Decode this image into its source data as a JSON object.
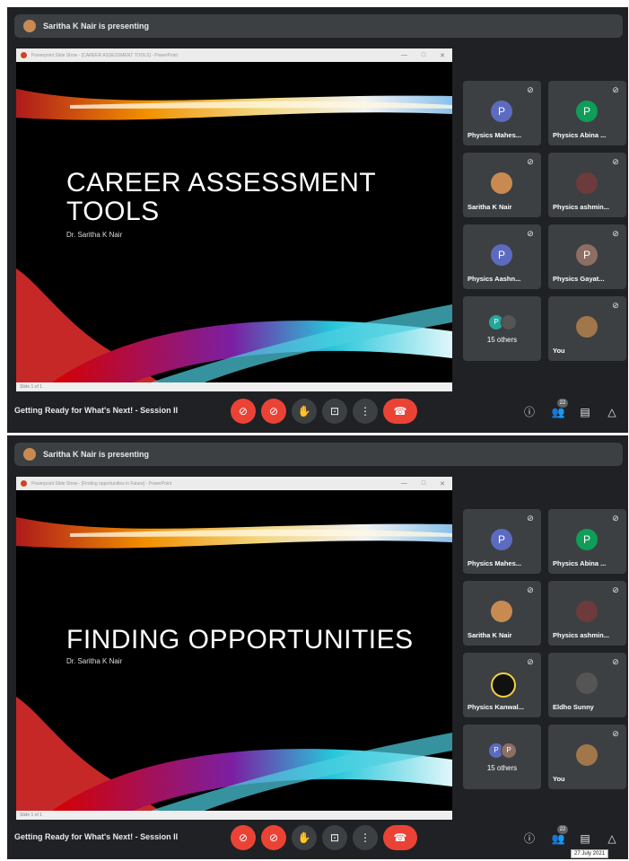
{
  "presenting_text": "Saritha K Nair is presenting",
  "meeting_title": "Getting Ready for What's Next! - Session II",
  "participant_count": "22",
  "date_tooltip": "27 July 2021",
  "slide1": {
    "window_title": "Powerpoint Slide Show - [CAREER ASSESSMENT TOOLS] - PowerPoint",
    "title_line1": "CAREER ASSESSMENT",
    "title_line2": "TOOLS",
    "subtitle": "Dr. Saritha K Nair",
    "footer": "Slide 1 of 1"
  },
  "slide2": {
    "window_title": "Powerpoint Slide Show - [Finding opportunities in Future] - PowerPoint",
    "title_line1": "FINDING OPPORTUNITIES",
    "subtitle": "Dr. Saritha K Nair",
    "footer": "Slide 1 of 1"
  },
  "tiles1": [
    {
      "name": "Physics Mahes...",
      "initial": "P",
      "color": "#5c6bc0"
    },
    {
      "name": "Physics Abina ...",
      "initial": "P",
      "color": "#0f9d58"
    },
    {
      "name": "Saritha K Nair",
      "initial": "",
      "color": "#c98a52"
    },
    {
      "name": "Physics ashmin...",
      "initial": "",
      "color": "#6d3b3b"
    },
    {
      "name": "Physics Aashn...",
      "initial": "P",
      "color": "#5c6bc0"
    },
    {
      "name": "Physics Gayat...",
      "initial": "P",
      "color": "#8d6e63"
    },
    {
      "name": "15 others",
      "initial": "P",
      "color": "#26a69a"
    },
    {
      "name": "You",
      "initial": "",
      "color": "#a0764a"
    }
  ],
  "tiles2": [
    {
      "name": "Physics Mahes...",
      "initial": "P",
      "color": "#5c6bc0"
    },
    {
      "name": "Physics Abina ...",
      "initial": "P",
      "color": "#0f9d58"
    },
    {
      "name": "Saritha K Nair",
      "initial": "",
      "color": "#c98a52"
    },
    {
      "name": "Physics ashmin...",
      "initial": "",
      "color": "#6d3b3b"
    },
    {
      "name": "Physics Kanwal...",
      "initial": "",
      "color": "#111111"
    },
    {
      "name": "Eldho Sunny",
      "initial": "",
      "color": "#555555"
    },
    {
      "name": "15 others",
      "initial": "P",
      "color": "#5c6bc0"
    },
    {
      "name": "You",
      "initial": "",
      "color": "#a0764a"
    }
  ],
  "icons": {
    "mic_off": "mic-off-icon",
    "cam_off": "camera-off-icon",
    "hand": "raise-hand-icon",
    "present": "present-icon",
    "more": "more-vert-icon",
    "end": "end-call-icon",
    "info": "info-icon",
    "people": "people-icon",
    "chat": "chat-icon",
    "activities": "activities-icon"
  }
}
